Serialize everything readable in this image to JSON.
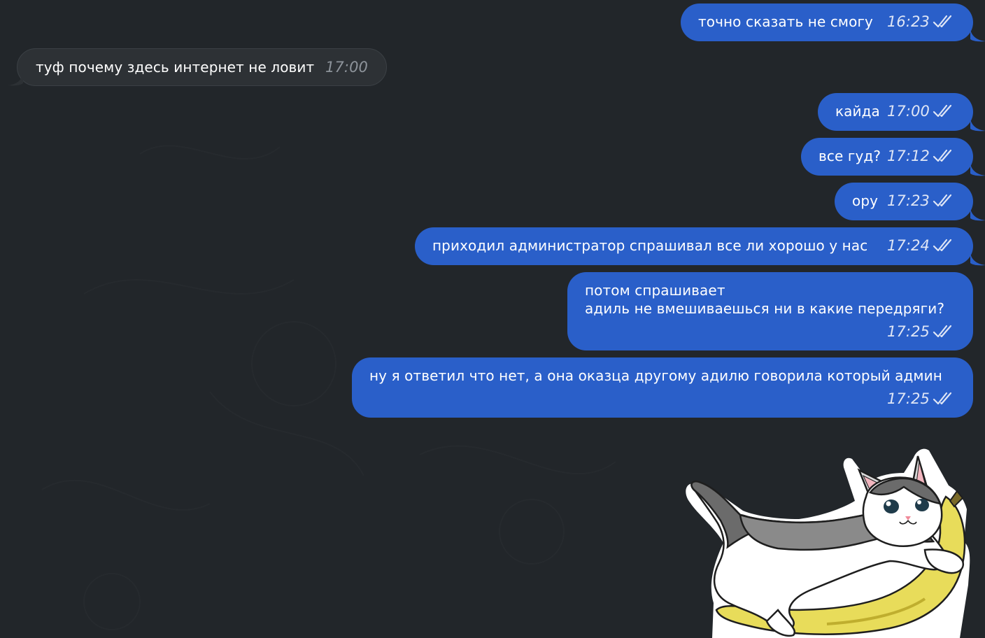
{
  "messages": [
    {
      "dir": "out",
      "text": "точно сказать не смогу",
      "time": "16:23",
      "status": "double-check-icon"
    },
    {
      "dir": "in",
      "text": "туф почему здесь интернет не ловит",
      "time": "17:00"
    },
    {
      "dir": "out",
      "text": "кайда",
      "time": "17:00",
      "status": "double-check-icon"
    },
    {
      "dir": "out",
      "text": "все гуд?",
      "time": "17:12",
      "status": "double-check-icon"
    },
    {
      "dir": "out",
      "text": "ору",
      "time": "17:23",
      "status": "double-check-icon"
    },
    {
      "dir": "out",
      "text": "приходил администратор спрашивал все ли хорошо у нас",
      "time": "17:24",
      "status": "double-check-icon"
    },
    {
      "dir": "out",
      "text": "потом спрашивает\nадиль не вмешиваешься ни в какие передряги?",
      "time": "17:25",
      "status": "double-check-icon"
    },
    {
      "dir": "out",
      "text": "ну я ответил что нет, а она оказца другому адилю говорила который админ",
      "time": "17:25",
      "status": "double-check-icon"
    }
  ],
  "sticker": {
    "icon": "cat-on-banana-sticker"
  },
  "colors": {
    "background": "#22262a",
    "outgoing_bubble": "#2a5fc9",
    "incoming_bubble": "#2d3135",
    "text": "#ffffff",
    "time_incoming": "#8d939a"
  }
}
